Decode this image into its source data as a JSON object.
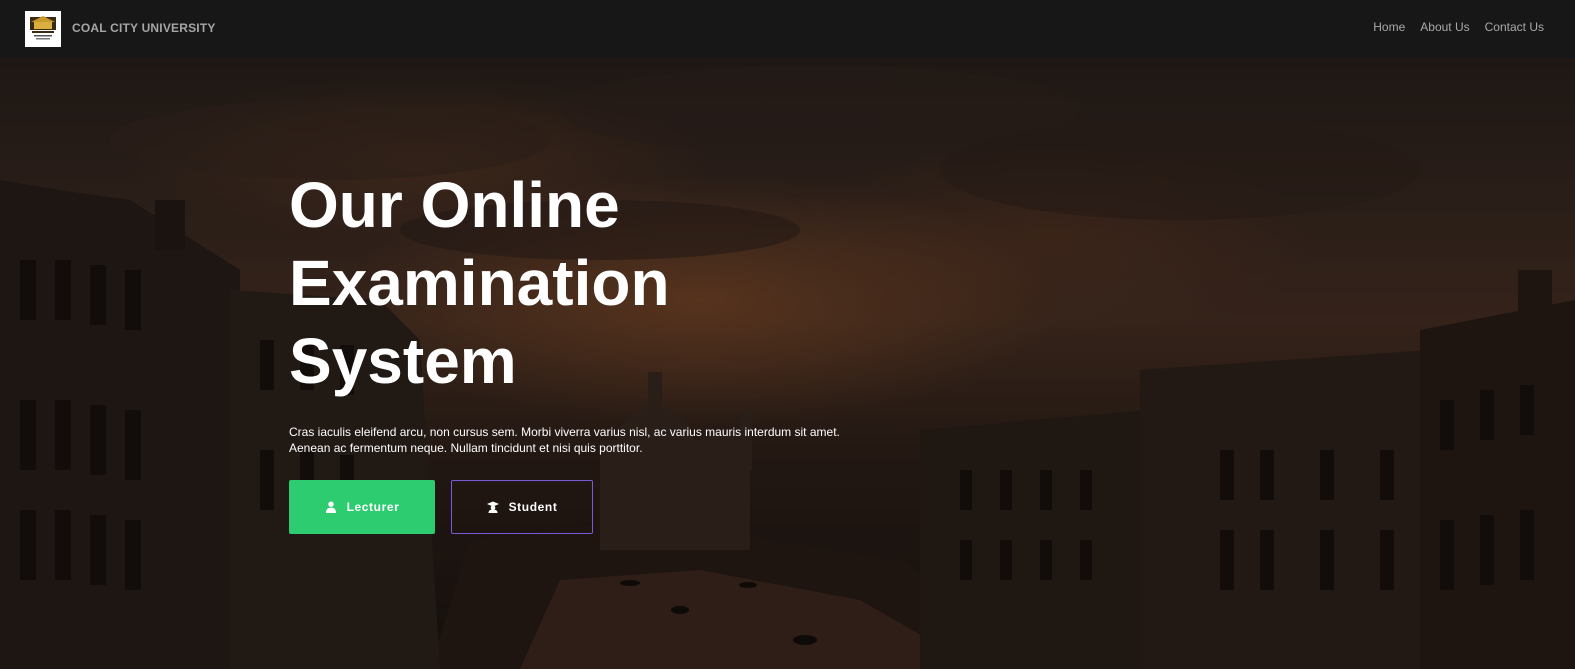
{
  "navbar": {
    "brand": "COAL CITY UNIVERSITY",
    "logo_icon": "university-logo",
    "links": [
      "Home",
      "About Us",
      "Contact Us"
    ]
  },
  "hero": {
    "title_lines": [
      "Our Online",
      "Examination",
      "System"
    ],
    "text_lines": [
      "Cras iaculis eleifend arcu, non cursus sem. Morbi viverra varius nisl, ac varius mauris interdum sit amet.",
      "Aenean ac fermentum neque. Nullam tincidunt et nisi quis porttitor."
    ],
    "buttons": {
      "lecturer": {
        "label": "Lecturer",
        "icon": "user-icon",
        "color": "#2ecc71"
      },
      "student": {
        "label": "Student",
        "icon": "graduate-icon",
        "border_color": "#7a5ad6"
      }
    }
  }
}
